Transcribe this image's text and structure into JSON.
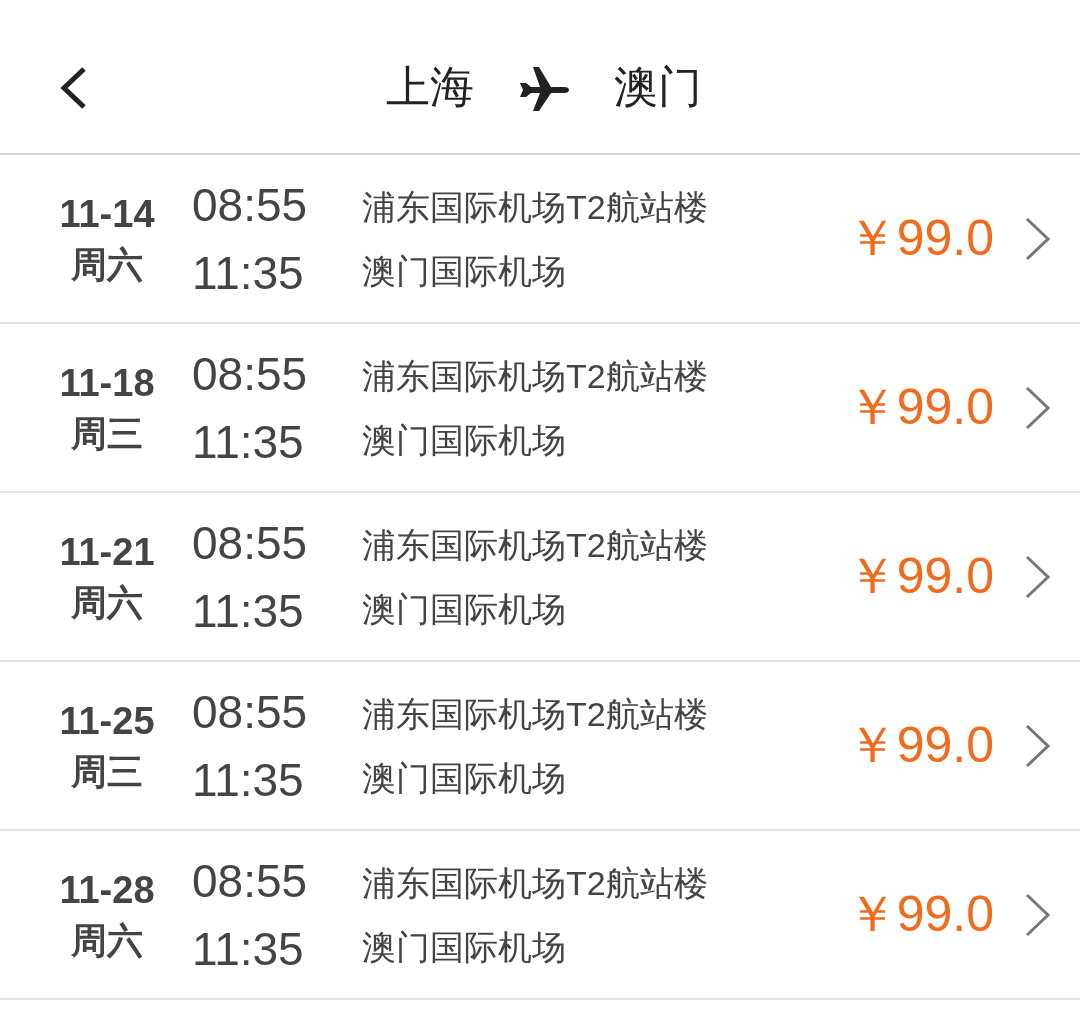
{
  "header": {
    "origin": "上海",
    "destination": "澳门"
  },
  "flights": [
    {
      "date": "11-14",
      "weekday": "周六",
      "depart_time": "08:55",
      "arrive_time": "11:35",
      "depart_airport": "浦东国际机场T2航站楼",
      "arrive_airport": "澳门国际机场",
      "price": "￥99.0"
    },
    {
      "date": "11-18",
      "weekday": "周三",
      "depart_time": "08:55",
      "arrive_time": "11:35",
      "depart_airport": "浦东国际机场T2航站楼",
      "arrive_airport": "澳门国际机场",
      "price": "￥99.0"
    },
    {
      "date": "11-21",
      "weekday": "周六",
      "depart_time": "08:55",
      "arrive_time": "11:35",
      "depart_airport": "浦东国际机场T2航站楼",
      "arrive_airport": "澳门国际机场",
      "price": "￥99.0"
    },
    {
      "date": "11-25",
      "weekday": "周三",
      "depart_time": "08:55",
      "arrive_time": "11:35",
      "depart_airport": "浦东国际机场T2航站楼",
      "arrive_airport": "澳门国际机场",
      "price": "￥99.0"
    },
    {
      "date": "11-28",
      "weekday": "周六",
      "depart_time": "08:55",
      "arrive_time": "11:35",
      "depart_airport": "浦东国际机场T2航站楼",
      "arrive_airport": "澳门国际机场",
      "price": "￥99.0"
    }
  ]
}
